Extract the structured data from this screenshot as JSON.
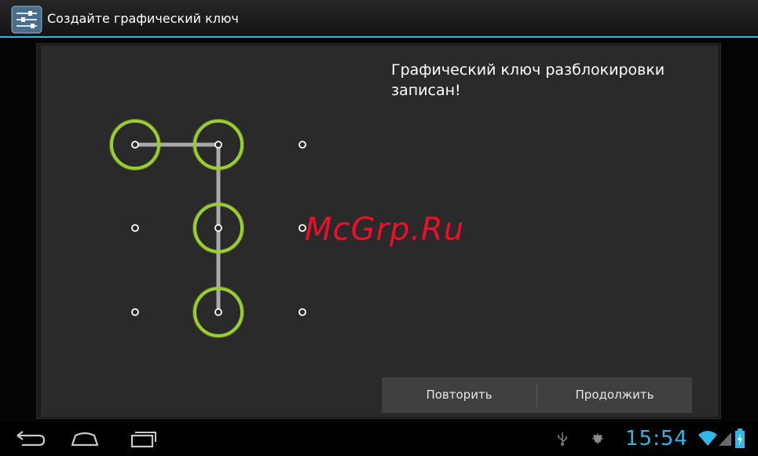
{
  "action_bar": {
    "title": "Создайте графический ключ",
    "icon": "settings-sliders-icon"
  },
  "content": {
    "header": "Графический ключ разблокировки записан!",
    "watermark": "McGrp.Ru",
    "pattern": {
      "grid_size": 3,
      "selected_sequence": [
        1,
        2,
        5,
        8
      ]
    }
  },
  "buttons": {
    "retry_label": "Повторить",
    "continue_label": "Продолжить"
  },
  "system_bar": {
    "nav_icons": [
      "back-icon",
      "home-icon",
      "recent-apps-icon"
    ],
    "status_icons": [
      "usb-icon",
      "debug-icon",
      "wifi-icon",
      "signal-icon",
      "battery-charging-icon"
    ],
    "time": "15:54"
  },
  "colors": {
    "accent": "#33b5e5",
    "pattern_ring": "#9acd32",
    "watermark": "#e8102a"
  }
}
